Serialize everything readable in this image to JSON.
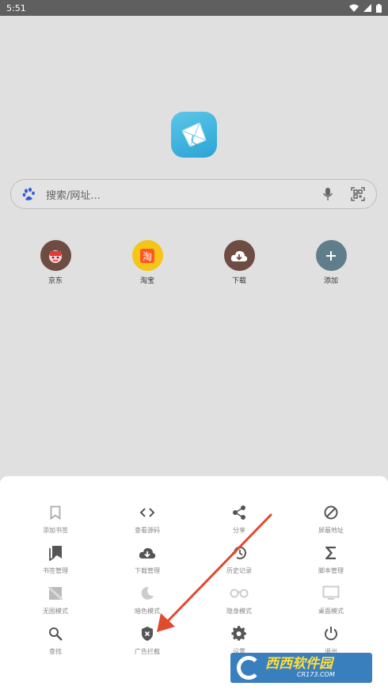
{
  "status_bar": {
    "time": "5:51"
  },
  "search": {
    "placeholder": "搜索/网址..."
  },
  "shortcuts": [
    {
      "label": "京东",
      "icon": "jd-icon",
      "color": "#6d4c41"
    },
    {
      "label": "淘宝",
      "icon": "taobao-icon",
      "color": "#f5c518"
    },
    {
      "label": "下载",
      "icon": "cloud-download-icon",
      "color": "#6d4c41"
    },
    {
      "label": "添加",
      "icon": "plus-icon",
      "color": "#607d8b"
    }
  ],
  "menu": {
    "rows": [
      [
        {
          "label": "添加书签",
          "icon": "bookmark-outline-icon"
        },
        {
          "label": "查看源码",
          "icon": "code-icon"
        },
        {
          "label": "分享",
          "icon": "share-icon"
        },
        {
          "label": "屏蔽地址",
          "icon": "block-icon"
        }
      ],
      [
        {
          "label": "书签管理",
          "icon": "bookmarks-icon"
        },
        {
          "label": "下载管理",
          "icon": "cloud-download-icon"
        },
        {
          "label": "历史记录",
          "icon": "history-icon"
        },
        {
          "label": "脚本管理",
          "icon": "sigma-icon"
        }
      ],
      [
        {
          "label": "无图模式",
          "icon": "no-image-icon"
        },
        {
          "label": "暗色模式",
          "icon": "moon-icon"
        },
        {
          "label": "隐身模式",
          "icon": "incognito-icon"
        },
        {
          "label": "桌面模式",
          "icon": "desktop-icon"
        }
      ],
      [
        {
          "label": "查找",
          "icon": "search-icon"
        },
        {
          "label": "广告拦截",
          "icon": "shield-block-icon"
        },
        {
          "label": "设置",
          "icon": "gear-icon"
        },
        {
          "label": "退出",
          "icon": "power-icon"
        }
      ]
    ]
  },
  "annotation": {
    "arrow_color": "#e04a2f"
  },
  "watermark": {
    "main": "西西软件园",
    "sub": "CR173.COM"
  }
}
